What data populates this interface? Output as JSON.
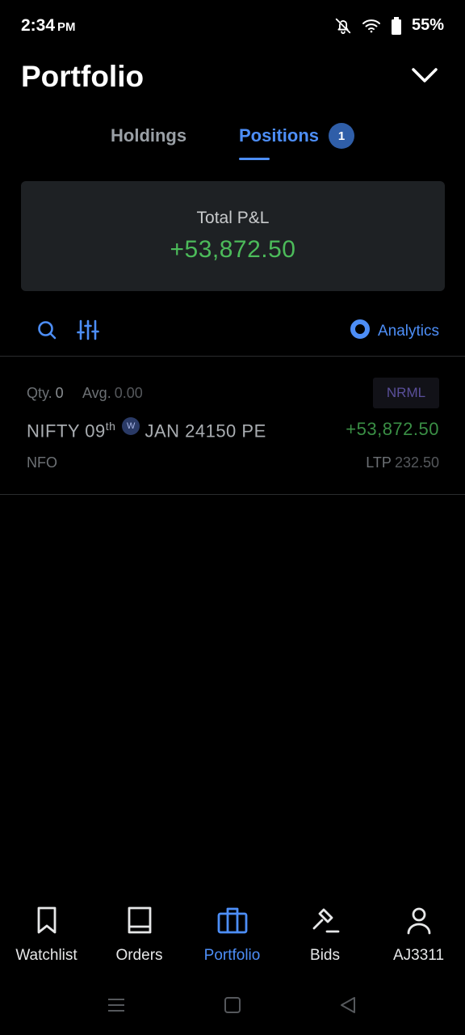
{
  "status_bar": {
    "time": "2:34",
    "ampm": "PM",
    "battery": "55%"
  },
  "header": {
    "title": "Portfolio"
  },
  "tabs": [
    {
      "label": "Holdings",
      "active": false
    },
    {
      "label": "Positions",
      "active": true,
      "badge": "1"
    }
  ],
  "summary": {
    "label": "Total P&L",
    "value": "+53,872.50",
    "color": "#4cbb5a"
  },
  "toolbar": {
    "analytics_label": "Analytics"
  },
  "positions": [
    {
      "qty_label": "Qty.",
      "qty": "0",
      "avg_label": "Avg.",
      "avg": "0.00",
      "product": "NRML",
      "symbol_prefix": "NIFTY 09",
      "symbol_sup": "th",
      "weekly_badge": "W",
      "symbol_suffix": "JAN 24150 PE",
      "pnl": "+53,872.50",
      "exchange": "NFO",
      "ltp_label": "LTP",
      "ltp": "232.50"
    }
  ],
  "bottom_nav": [
    {
      "label": "Watchlist",
      "icon": "bookmark-icon",
      "active": false
    },
    {
      "label": "Orders",
      "icon": "book-icon",
      "active": false
    },
    {
      "label": "Portfolio",
      "icon": "briefcase-icon",
      "active": true
    },
    {
      "label": "Bids",
      "icon": "gavel-icon",
      "active": false
    },
    {
      "label": "AJ3311",
      "icon": "user-icon",
      "active": false
    }
  ],
  "colors": {
    "accent": "#4d8ef7",
    "profit": "#4cbb5a",
    "background": "#000000"
  }
}
